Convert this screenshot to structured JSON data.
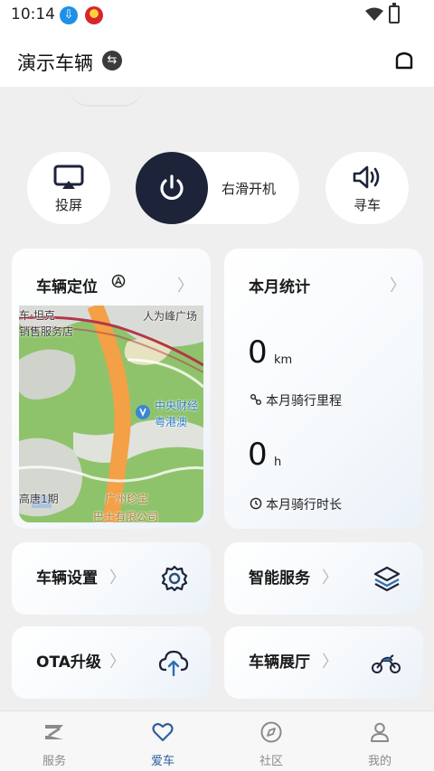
{
  "statusbar": {
    "time": "10:14",
    "download_icon": "download-icon",
    "app_icon": "app-notification-icon"
  },
  "header": {
    "title": "演示车辆",
    "swap_icon": "swap-icon",
    "home_icon": "home-icon"
  },
  "controls": {
    "cast_label": "投屏",
    "power_label": "右滑开机",
    "find_label": "寻车"
  },
  "location_card": {
    "title": "车辆定位",
    "map_labels": {
      "l1": "车·坦克",
      "l2": "销售服务店",
      "l3": "人为峰广场",
      "l4": "中央财经",
      "l5": "粤港澳",
      "l6": "高唐1期",
      "l7": "广州珍宝",
      "l8": "巴士有限公司"
    }
  },
  "stats_card": {
    "title": "本月统计",
    "distance_value": "0",
    "distance_unit": "km",
    "distance_label": "本月骑行里程",
    "duration_value": "0",
    "duration_unit": "h",
    "duration_label": "本月骑行时长"
  },
  "tiles": {
    "settings": "车辆设置",
    "smart": "智能服务",
    "ota": "OTA升级",
    "showroom": "车辆展厅"
  },
  "tabbar": {
    "services": "服务",
    "car": "爱车",
    "community": "社区",
    "mine": "我的"
  },
  "colors": {
    "accent": "#2f5f9b",
    "dark": "#1d2338",
    "icon_blue": "#2b4f7d"
  }
}
